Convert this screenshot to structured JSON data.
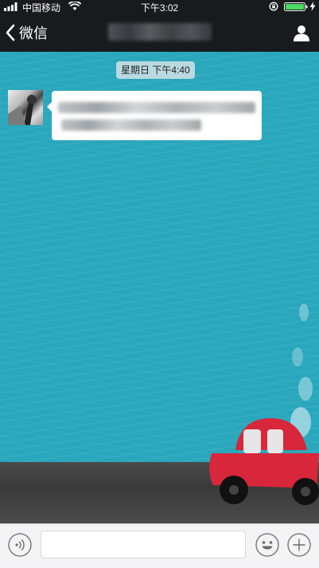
{
  "status_bar": {
    "carrier": "中国移动",
    "time": "下午3:02",
    "icons": [
      "signal-icon",
      "wifi-icon",
      "orientation-lock-icon",
      "battery-icon",
      "charging-icon"
    ],
    "battery_color": "#4cd964"
  },
  "nav_bar": {
    "back_label": "微信",
    "title_obscured": true,
    "contact_icon": "person-icon"
  },
  "chat": {
    "timestamp": "星期日 下午4:40",
    "messages": [
      {
        "side": "left",
        "text_obscured": true
      }
    ],
    "wallpaper": "teal-sky-with-red-car",
    "wallpaper_color": "#2aa8bd"
  },
  "input_bar": {
    "voice_icon": "voice-icon",
    "message_value": "",
    "emoji_icon": "emoji-icon",
    "more_icon": "plus-icon"
  }
}
